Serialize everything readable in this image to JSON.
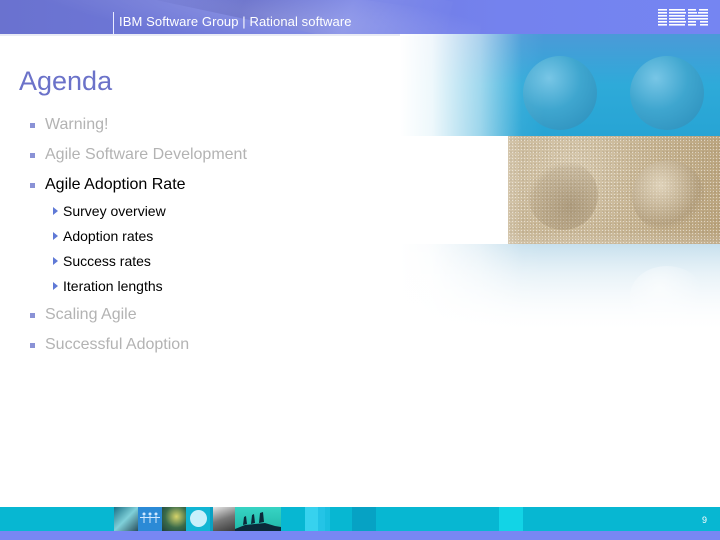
{
  "header": {
    "title": "IBM Software Group | Rational software",
    "logo": "IBM",
    "logo_icon": "ibm-logo-icon"
  },
  "slide": {
    "title": "Agenda",
    "items": [
      {
        "label": "Warning!",
        "state": "dimmed"
      },
      {
        "label": "Agile Software Development",
        "state": "dimmed"
      },
      {
        "label": "Agile Adoption Rate",
        "state": "active",
        "subitems": [
          {
            "label": "Survey overview"
          },
          {
            "label": "Adoption rates"
          },
          {
            "label": "Success rates"
          },
          {
            "label": "Iteration lengths"
          }
        ]
      },
      {
        "label": "Scaling Agile",
        "state": "dimmed"
      },
      {
        "label": "Successful Adoption",
        "state": "dimmed"
      }
    ]
  },
  "footer": {
    "page_number": "9"
  },
  "colors": {
    "header_band": "#7079e0",
    "title": "#6b72c9",
    "bullet": "#8a92d6",
    "dimmed_text": "#b3b3b3",
    "active_text": "#000000",
    "footer_band": "#07b7d2",
    "footer_bottom": "#7887f3"
  }
}
